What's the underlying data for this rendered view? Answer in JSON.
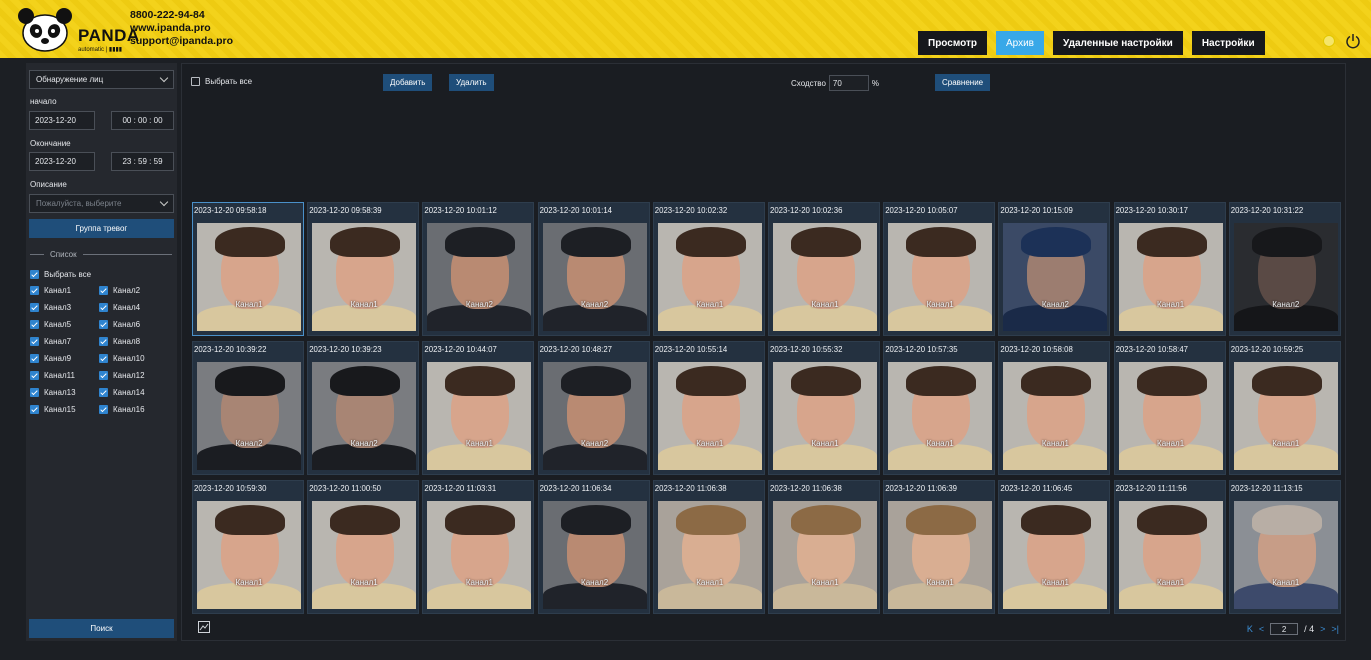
{
  "header": {
    "brand_name": "PANDA",
    "brand_sub": "automatic | ▮▮▮▮",
    "phone": "8800-222-94-84",
    "website": "www.ipanda.pro",
    "email": "support@ipanda.pro",
    "nav": [
      {
        "label": "Просмотр",
        "active": false
      },
      {
        "label": "Архив",
        "active": true
      },
      {
        "label": "Удаленные настройки",
        "active": false
      },
      {
        "label": "Настройки",
        "active": false
      }
    ]
  },
  "sidebar": {
    "mode_value": "Обнаружение лиц",
    "start_label": "начало",
    "start_date": "2023-12-20",
    "start_time": "00 : 00 : 00",
    "end_label": "Окончание",
    "end_date": "2023-12-20",
    "end_time": "23 : 59 : 59",
    "desc_label": "Описание",
    "desc_placeholder": "Пожалуйста, выберите",
    "alarm_group_button": "Группа тревог",
    "list_label": "Список",
    "select_all": "Выбрать все",
    "channels": [
      "Канал1",
      "Канал2",
      "Канал3",
      "Канал4",
      "Канал5",
      "Канал6",
      "Канал7",
      "Канал8",
      "Канал9",
      "Канал10",
      "Канал11",
      "Канал12",
      "Канал13",
      "Канал14",
      "Канал15",
      "Канал16"
    ],
    "search_button": "Поиск"
  },
  "toolbar": {
    "select_all": "Выбрать все",
    "add_button": "Добавить",
    "delete_button": "Удалить",
    "similarity_label": "Сходство",
    "similarity_value": "70",
    "similarity_unit": "%",
    "compare_button": "Сравнение"
  },
  "results": [
    {
      "time": "2023-12-20 09:58:18",
      "channel": "Канал1",
      "look": "a"
    },
    {
      "time": "2023-12-20 09:58:39",
      "channel": "Канал1",
      "look": "a"
    },
    {
      "time": "2023-12-20 10:01:12",
      "channel": "Канал2",
      "look": "beanie"
    },
    {
      "time": "2023-12-20 10:01:14",
      "channel": "Канал2",
      "look": "beanie"
    },
    {
      "time": "2023-12-20 10:02:32",
      "channel": "Канал1",
      "look": "a"
    },
    {
      "time": "2023-12-20 10:02:36",
      "channel": "Канал1",
      "look": "a"
    },
    {
      "time": "2023-12-20 10:05:07",
      "channel": "Канал1",
      "look": "a"
    },
    {
      "time": "2023-12-20 10:15:09",
      "channel": "Канал2",
      "look": "hood"
    },
    {
      "time": "2023-12-20 10:30:17",
      "channel": "Канал1",
      "look": "a"
    },
    {
      "time": "2023-12-20 10:31:22",
      "channel": "Канал2",
      "look": "dark"
    },
    {
      "time": "2023-12-20 10:39:22",
      "channel": "Канал2",
      "look": "cap"
    },
    {
      "time": "2023-12-20 10:39:23",
      "channel": "Канал2",
      "look": "cap"
    },
    {
      "time": "2023-12-20 10:44:07",
      "channel": "Канал1",
      "look": "a"
    },
    {
      "time": "2023-12-20 10:48:27",
      "channel": "Канал2",
      "look": "beanie"
    },
    {
      "time": "2023-12-20 10:55:14",
      "channel": "Канал1",
      "look": "a"
    },
    {
      "time": "2023-12-20 10:55:32",
      "channel": "Канал1",
      "look": "a"
    },
    {
      "time": "2023-12-20 10:57:35",
      "channel": "Канал1",
      "look": "a"
    },
    {
      "time": "2023-12-20 10:58:08",
      "channel": "Канал1",
      "look": "a"
    },
    {
      "time": "2023-12-20 10:58:47",
      "channel": "Канал1",
      "look": "a"
    },
    {
      "time": "2023-12-20 10:59:25",
      "channel": "Канал1",
      "look": "a"
    },
    {
      "time": "2023-12-20 10:59:30",
      "channel": "Канал1",
      "look": "a"
    },
    {
      "time": "2023-12-20 11:00:50",
      "channel": "Канал1",
      "look": "a"
    },
    {
      "time": "2023-12-20 11:03:31",
      "channel": "Канал1",
      "look": "a"
    },
    {
      "time": "2023-12-20 11:06:34",
      "channel": "Канал2",
      "look": "beanie"
    },
    {
      "time": "2023-12-20 11:06:38",
      "channel": "Канал1",
      "look": "woman"
    },
    {
      "time": "2023-12-20 11:06:38",
      "channel": "Канал1",
      "look": "woman"
    },
    {
      "time": "2023-12-20 11:06:39",
      "channel": "Канал1",
      "look": "woman"
    },
    {
      "time": "2023-12-20 11:06:45",
      "channel": "Канал1",
      "look": "a"
    },
    {
      "time": "2023-12-20 11:11:56",
      "channel": "Канал1",
      "look": "a"
    },
    {
      "time": "2023-12-20 11:13:15",
      "channel": "Канал1",
      "look": "old"
    }
  ],
  "pager": {
    "first": "K",
    "prev": "<",
    "current": "2",
    "total": "/ 4",
    "next": ">",
    "last": ">|"
  },
  "colors": {
    "header_yellow": "#f3d21b",
    "accent_blue": "#38a8e8",
    "button_blue": "#1f4e7a"
  }
}
